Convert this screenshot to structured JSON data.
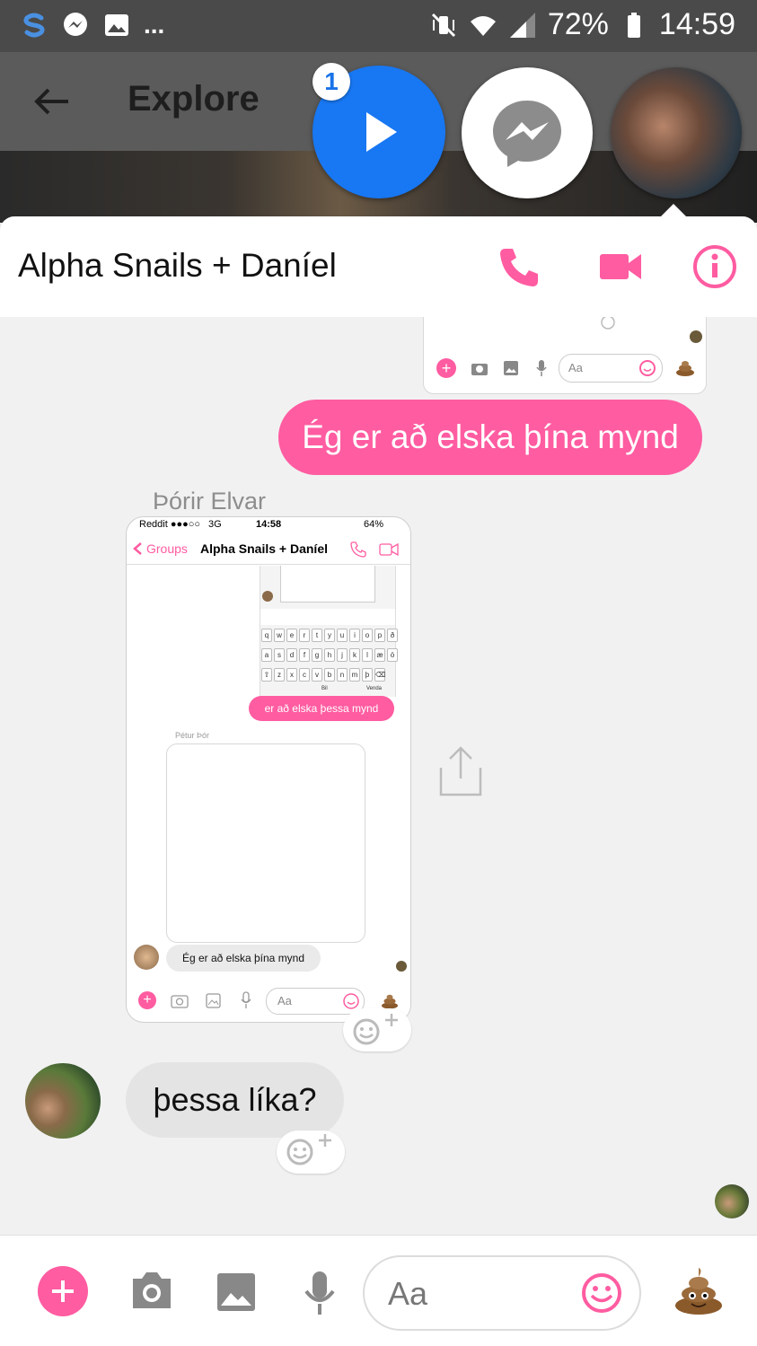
{
  "status_bar": {
    "battery": "72%",
    "time": "14:59",
    "more": "..."
  },
  "app_bar": {
    "title": "Explore"
  },
  "chat_heads": {
    "badge_count": "1"
  },
  "conversation": {
    "title": "Alpha Snails + Daníel"
  },
  "messages": {
    "outgoing_text": "Ég er að elska þína mynd",
    "sender_name": "Þórir Elvar",
    "incoming_text": "þessa líka?"
  },
  "screenshot": {
    "carrier": "Reddit ●●●○○",
    "network": "3G",
    "time": "14:58",
    "battery": "64%",
    "back_label": "Groups",
    "title": "Alpha Snails + Daníel",
    "mini_input_placeholder": "Aa",
    "keyboard_row1": [
      "q",
      "w",
      "e",
      "r",
      "t",
      "y",
      "u",
      "i",
      "o",
      "p",
      "ð"
    ],
    "keyboard_row2": [
      "a",
      "s",
      "d",
      "f",
      "g",
      "h",
      "j",
      "k",
      "l",
      "æ",
      "ö"
    ],
    "keyboard_row3": [
      "z",
      "x",
      "c",
      "v",
      "b",
      "n",
      "m",
      "þ"
    ],
    "keyboard_label_space": "Bil",
    "keyboard_label_send": "Venda",
    "pink_message": "er að elska þessa mynd",
    "sender_name": "Pétur Þór",
    "gray_message": "Ég er að elska þína mynd",
    "input_placeholder": "Aa"
  },
  "composer": {
    "placeholder": "Aa"
  },
  "colors": {
    "accent": "#ff5ca1",
    "messenger_blue": "#1a73e8",
    "status_bg": "#4a4a4a"
  }
}
